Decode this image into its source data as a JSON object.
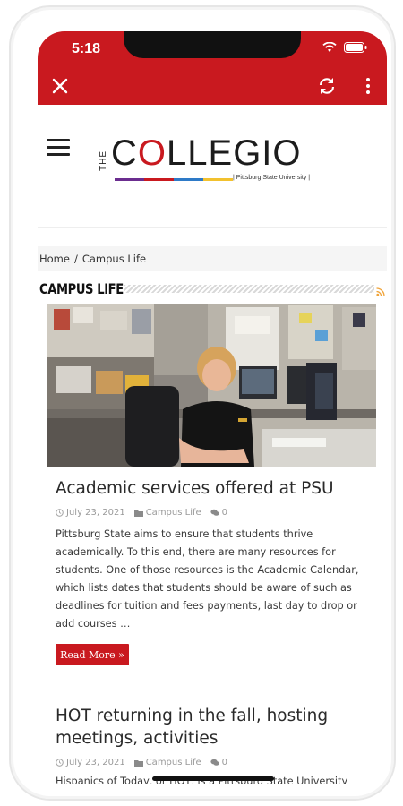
{
  "status_bar": {
    "time": "5:18"
  },
  "header": {
    "logo": {
      "prefix": "THE",
      "word": "COLLEGIO",
      "subtitle": "| Pittsburg State University |"
    }
  },
  "breadcrumb": {
    "home": "Home",
    "separator": "/",
    "current": "Campus Life"
  },
  "section": {
    "title": "CAMPUS LIFE"
  },
  "articles": [
    {
      "title": "Academic services offered at PSU",
      "date": "July 23, 2021",
      "category": "Campus Life",
      "comments": "0",
      "excerpt_lines": [
        "Pittsburg State aims to ensure that students thrive",
        "academically. To this end, there are many resources for",
        "students.  One of those resources is the Academic Calendar,",
        "which lists dates that students should be aware of such as",
        "deadlines for tuition and fees payments, last day to drop or",
        "add courses …"
      ],
      "read_more": "Read More »"
    },
    {
      "title_lines": [
        "HOT returning in the fall, hosting",
        "meetings, activities"
      ],
      "date": "July 23, 2021",
      "category": "Campus Life",
      "comments": "0",
      "excerpt_partial": "Hispanics of Today, or HOT, is a Pittsburg State University"
    }
  ],
  "colors": {
    "brand_red": "#c9191f",
    "text_dark": "#2a2a2a",
    "meta_gray": "#9a9a9a"
  },
  "icons": [
    "close-icon",
    "refresh-icon",
    "more-vert-icon",
    "menu-icon",
    "rss-icon",
    "clock-icon",
    "folder-icon",
    "comment-icon",
    "wifi-icon",
    "battery-icon",
    "signal-icon"
  ]
}
